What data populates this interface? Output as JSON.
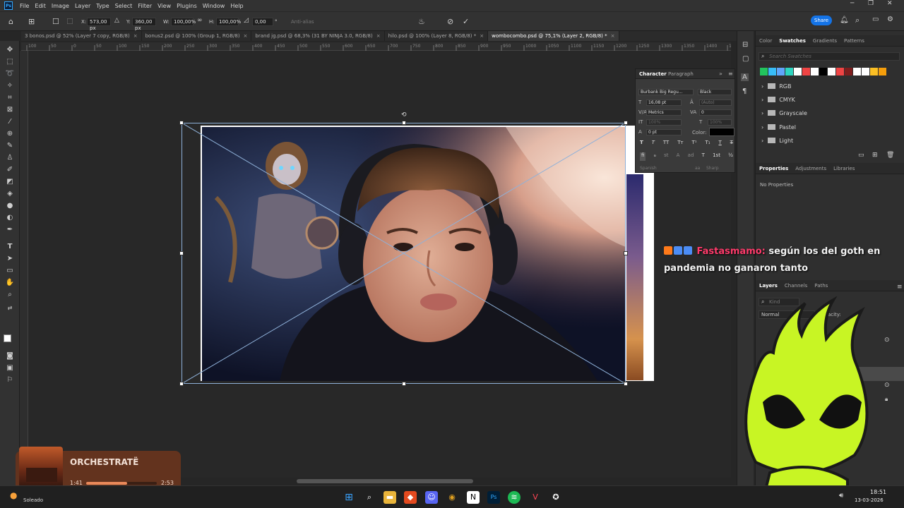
{
  "menubar": {
    "app_logo": "Ps",
    "items": [
      "File",
      "Edit",
      "Image",
      "Layer",
      "Type",
      "Select",
      "Filter",
      "View",
      "Plugins",
      "Window",
      "Help"
    ]
  },
  "options_bar": {
    "x_label": "X:",
    "x_value": "573,00 px",
    "y_label": "Y:",
    "y_value": "360,00 px",
    "w_label": "W:",
    "w_value": "100,00%",
    "h_label": "H:",
    "h_value": "100,00%",
    "rotate_value": "0,00",
    "degree_sign": "°",
    "antialias": "Anti-alias",
    "share_label": "Share"
  },
  "tabs": [
    {
      "label": "3 bonos.psd @ 52% (Layer 7 copy, RGB/8)",
      "active": false
    },
    {
      "label": "bonus2.psd @ 100% (Group 1, RGB/8)",
      "active": false
    },
    {
      "label": "brand jg.psd @ 68,3% (31 BY NINJA 3.0, RGB/8)",
      "active": false
    },
    {
      "label": "hilo.psd @ 100% (Layer 8, RGB/8) *",
      "active": false
    },
    {
      "label": "wombocombo.psd @ 75,1% (Layer 2, RGB/8) *",
      "active": true
    }
  ],
  "tab_close": "×",
  "ruler_ticks": [
    "100",
    "50",
    "0",
    "50",
    "100",
    "150",
    "200",
    "250",
    "300",
    "350",
    "400",
    "450",
    "500",
    "550",
    "600",
    "650",
    "700",
    "750",
    "800",
    "850",
    "900",
    "950",
    "1000",
    "1050",
    "1100",
    "1150",
    "1200",
    "1250",
    "1300",
    "1350",
    "1400",
    "1450"
  ],
  "swatches_panel": {
    "tabs": [
      "Color",
      "Swatches",
      "Gradients",
      "Patterns"
    ],
    "active_tab": "Swatches",
    "search_placeholder": "Search Swatches",
    "swatch_colors": [
      "#22c55e",
      "#38bdf8",
      "#60a5fa",
      "#2dd4bf",
      "#ffffff",
      "#ef4444",
      "#ffffff",
      "#000000",
      "#ffffff",
      "#ef4444",
      "#7f1d1d",
      "#ffffff",
      "#ffffff",
      "#fbbf24",
      "#f59e0b"
    ],
    "groups": [
      "RGB",
      "CMYK",
      "Grayscale",
      "Pastel",
      "Light"
    ]
  },
  "properties_panel": {
    "tabs": [
      "Properties",
      "Adjustments",
      "Libraries"
    ],
    "active_tab": "Properties",
    "empty_text": "No Properties"
  },
  "layers_panel": {
    "tabs": [
      "Layers",
      "Channels",
      "Paths"
    ],
    "active_tab": "Layers",
    "search_placeholder": "Kind",
    "blend_mode": "Normal",
    "opacity_label": "Opacity:"
  },
  "character_panel": {
    "tabs": [
      "Character",
      "Paragraph"
    ],
    "active_tab": "Character",
    "font_family": "Burbank Big Regu...",
    "font_style": "Black",
    "font_size": "16,08 pt",
    "leading": "(Auto)",
    "kerning": "Metrics",
    "tracking": "0",
    "vscale": "100%",
    "hscale": "100%",
    "baseline": "0 pt",
    "color_label": "Color:",
    "language": "Spanish",
    "antialias": "Sharp",
    "style_buttons": [
      "T",
      "T",
      "TT",
      "Tт",
      "T¹",
      "T₁",
      "T",
      "T"
    ],
    "glyph_buttons": [
      "fi",
      "ℴ",
      "st",
      "A",
      "ad",
      "T",
      "1st",
      "½"
    ]
  },
  "chat": {
    "badges": [
      "#ff7a1a",
      "#4c8df6",
      "#4c8df6"
    ],
    "username": "Fastasmamo:",
    "message": "según los del goth en pandemia no ganaron tanto"
  },
  "music_widget": {
    "title": "ORCHESTRATË",
    "elapsed": "1:41",
    "duration": "2:53",
    "progress": 0.58
  },
  "weather": {
    "status": "Soleado"
  },
  "system_tray": {
    "time": "18:51",
    "date": "13-03-2026"
  },
  "colors": {
    "accent": "#1473e6",
    "selection": "#8fb1d9",
    "mascot": "#c8f524"
  }
}
